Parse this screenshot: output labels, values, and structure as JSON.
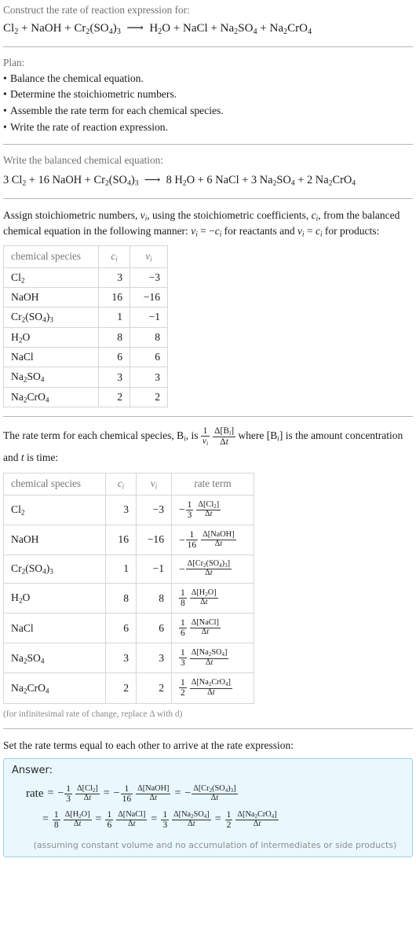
{
  "header": {
    "prompt": "Construct the rate of reaction expression for:",
    "equation_reactants": [
      "Cl_2",
      "NaOH",
      "Cr_2(SO_4)_3"
    ],
    "equation_products": [
      "H_2O",
      "NaCl",
      "Na_2SO_4",
      "Na_2CrO_4"
    ],
    "arrow": "⟶"
  },
  "plan": {
    "label": "Plan:",
    "items": [
      "Balance the chemical equation.",
      "Determine the stoichiometric numbers.",
      "Assemble the rate term for each chemical species.",
      "Write the rate of reaction expression."
    ]
  },
  "balanced": {
    "label": "Write the balanced chemical equation:",
    "reactant_coeffs": [
      "3",
      "16",
      ""
    ],
    "product_coeffs": [
      "8",
      "6",
      "3",
      "2"
    ]
  },
  "assign": {
    "text_part1": "Assign stoichiometric numbers, ",
    "sym_nu": "ν",
    "sym_i": "i",
    "text_part2": ", using the stoichiometric coefficients, ",
    "sym_c": "c",
    "text_part3": ", from the balanced chemical equation in the following manner: ",
    "formula1": "ν_i = −c_i",
    "text_part4": " for reactants and ",
    "formula2": "ν_i = c_i",
    "text_part5": " for products:"
  },
  "table1": {
    "headers": [
      "chemical species",
      "c_i",
      "ν_i"
    ],
    "rows": [
      {
        "species": "Cl_2",
        "c": "3",
        "nu": "−3"
      },
      {
        "species": "NaOH",
        "c": "16",
        "nu": "−16"
      },
      {
        "species": "Cr_2(SO_4)_3",
        "c": "1",
        "nu": "−1"
      },
      {
        "species": "H_2O",
        "c": "8",
        "nu": "8"
      },
      {
        "species": "NaCl",
        "c": "6",
        "nu": "6"
      },
      {
        "species": "Na_2SO_4",
        "c": "3",
        "nu": "3"
      },
      {
        "species": "Na_2CrO_4",
        "c": "2",
        "nu": "2"
      }
    ]
  },
  "rateterm_intro": {
    "part1": "The rate term for each chemical species, B",
    "part2": ", is ",
    "part3": " where [B",
    "part4": "] is the amount concentration and ",
    "part5": "t",
    "part6": " is time:"
  },
  "table2": {
    "headers": [
      "chemical species",
      "c_i",
      "ν_i",
      "rate term"
    ],
    "rows": [
      {
        "species": "Cl_2",
        "c": "3",
        "nu": "−3",
        "sign": "−",
        "frac_num": "1",
        "frac_den": "3",
        "delta": "Δ[Cl_2]",
        "dt": "Δt"
      },
      {
        "species": "NaOH",
        "c": "16",
        "nu": "−16",
        "sign": "−",
        "frac_num": "1",
        "frac_den": "16",
        "delta": "Δ[NaOH]",
        "dt": "Δt"
      },
      {
        "species": "Cr_2(SO_4)_3",
        "c": "1",
        "nu": "−1",
        "sign": "−",
        "frac_num": "",
        "frac_den": "",
        "delta": "Δ[Cr_2(SO_4)_3]",
        "dt": "Δt"
      },
      {
        "species": "H_2O",
        "c": "8",
        "nu": "8",
        "sign": "",
        "frac_num": "1",
        "frac_den": "8",
        "delta": "Δ[H_2O]",
        "dt": "Δt"
      },
      {
        "species": "NaCl",
        "c": "6",
        "nu": "6",
        "sign": "",
        "frac_num": "1",
        "frac_den": "6",
        "delta": "Δ[NaCl]",
        "dt": "Δt"
      },
      {
        "species": "Na_2SO_4",
        "c": "3",
        "nu": "3",
        "sign": "",
        "frac_num": "1",
        "frac_den": "3",
        "delta": "Δ[Na_2SO_4]",
        "dt": "Δt"
      },
      {
        "species": "Na_2CrO_4",
        "c": "2",
        "nu": "2",
        "sign": "",
        "frac_num": "1",
        "frac_den": "2",
        "delta": "Δ[Na_2CrO_4]",
        "dt": "Δt"
      }
    ],
    "footnote": "(for infinitesimal rate of change, replace Δ with d)"
  },
  "final": {
    "label": "Set the rate terms equal to each other to arrive at the rate expression:",
    "answer_label": "Answer:",
    "rate_word": "rate",
    "equals": "=",
    "assumption": "(assuming constant volume and no accumulation of intermediates or side products)"
  }
}
